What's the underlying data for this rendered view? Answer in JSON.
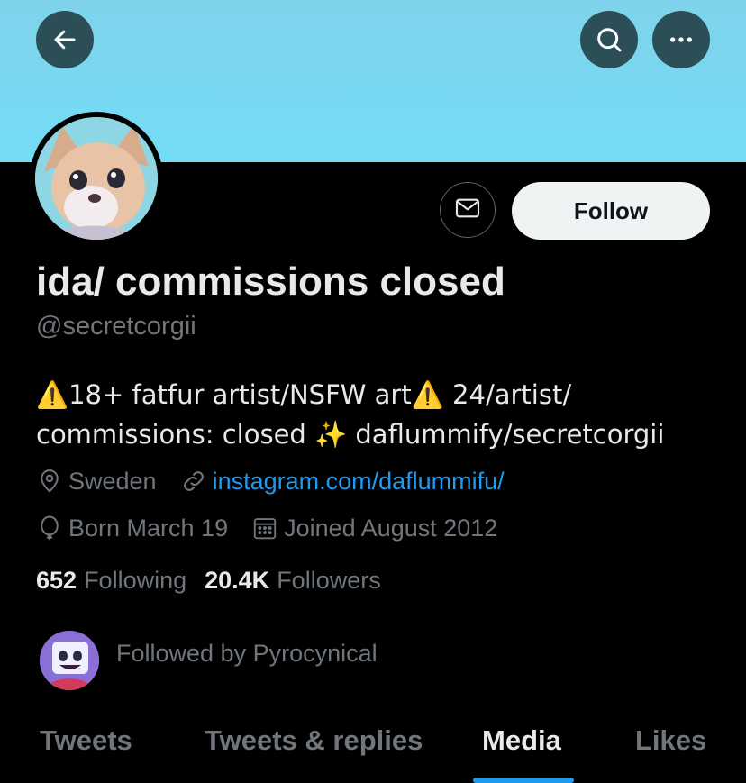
{
  "header": {
    "back_icon": "arrow-left-icon",
    "search_icon": "search-icon",
    "more_icon": "more-horizontal-icon",
    "banner_color": "#74dcf6"
  },
  "profile": {
    "display_name": "ida/ commissions closed",
    "handle": "@secretcorgii",
    "bio_line1": "⚠️18+ fatfur artist/NSFW art⚠️ 24/artist/",
    "bio_line2": "commissions: closed ✨ daflummify/secretcorgii",
    "location": "Sweden",
    "website": "instagram.com/daflummifu/",
    "birthday": "Born March 19",
    "joined": "Joined August 2012",
    "following_count": "652",
    "following_label": "Following",
    "followers_count": "20.4K",
    "followers_label": "Followers",
    "followed_by": "Followed by Pyrocynical"
  },
  "actions": {
    "message_icon": "envelope-icon",
    "follow_label": "Follow"
  },
  "tabs": [
    {
      "label": "Tweets",
      "active": false
    },
    {
      "label": "Tweets & replies",
      "active": false
    },
    {
      "label": "Media",
      "active": true
    },
    {
      "label": "Likes",
      "active": false
    }
  ],
  "colors": {
    "accent": "#1d9bf0",
    "background": "#000000",
    "muted_text": "#71767b",
    "primary_text": "#e7e9ea"
  }
}
